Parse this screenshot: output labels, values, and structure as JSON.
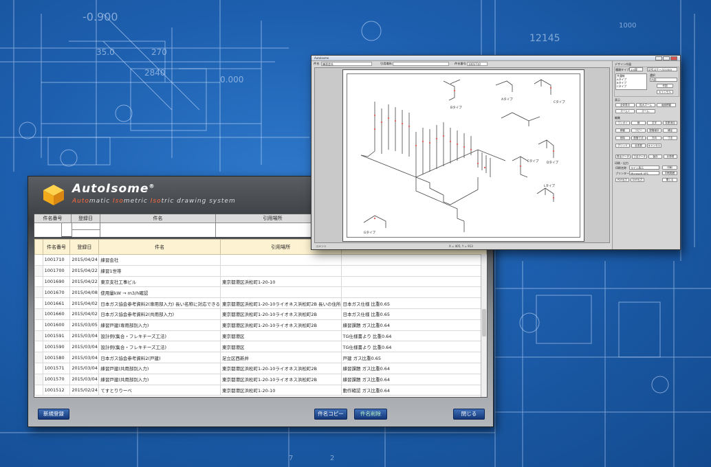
{
  "app": {
    "name_prefix": "AutoIsome",
    "reg_mark": "®",
    "subtitle_parts": [
      {
        "text": "Auto",
        "hl": true
      },
      {
        "text": "matic ",
        "hl": false
      },
      {
        "text": "Iso",
        "hl": true
      },
      {
        "text": "metric ",
        "hl": false
      },
      {
        "text": "Iso",
        "hl": true
      },
      {
        "text": "tric drawing system",
        "hl": false
      }
    ]
  },
  "search": {
    "headers": [
      "件名番号",
      "登録日",
      "件名",
      "引用場所"
    ]
  },
  "table": {
    "headers": [
      "件名番号",
      "登録日",
      "件名",
      "引用場所",
      ""
    ],
    "rows": [
      [
        "1001710",
        "2015/04/24",
        "練習会社",
        "",
        ""
      ],
      [
        "1001700",
        "2015/04/22",
        "練習1世帯",
        "",
        ""
      ],
      [
        "1001690",
        "2015/04/22",
        "東京支社工事ビル",
        "東京都港区浜松町1-20-10",
        ""
      ],
      [
        "1001670",
        "2015/04/08",
        "使用量kW → m3/h確認",
        "",
        ""
      ],
      [
        "1001661",
        "2015/04/02",
        "日本ガス協会参考資料2(専用部入力) 長い名称に対応できる",
        "東京都港区浜松町1-20-10ライオネス浜松町2B 長いの住所",
        "日本ガス仕様 比重0.65"
      ],
      [
        "1001660",
        "2015/04/02",
        "日本ガス協会参考資料2(共用部入力)",
        "東京都港区浜松町1-20-10ライオネス浜松町2B",
        "日本ガス仕様 比重0.65"
      ],
      [
        "1001600",
        "2015/03/05",
        "練習戸建(専用部別入力)",
        "東京都港区浜松町1-20-10ライオネス浜松町2B",
        "練習課題 ガス比重0.64"
      ],
      [
        "1001591",
        "2015/03/04",
        "設計例(集合・フレキチーズ工法)",
        "東京都港区",
        "TG仕様書より 比重0.64"
      ],
      [
        "1001590",
        "2015/03/04",
        "設計例(集合・フレキチーズ工法)",
        "東京都港区",
        "TG仕様書より 比重0.64"
      ],
      [
        "1001580",
        "2015/03/04",
        "日本ガス協会参考資料2(戸建)",
        "足立区西新井",
        "戸建 ガス比重0.65"
      ],
      [
        "1001571",
        "2015/03/04",
        "練習戸建(共用部別入力)",
        "東京都港区浜松町1-20-10ライオネス浜松町2B",
        "練習課題 ガス比重0.64"
      ],
      [
        "1001570",
        "2015/03/04",
        "練習戸建(共用部別入力)",
        "東京都港区浜松町1-20-10ライオネス浜松町2B",
        "練習課題 ガス比重0.64"
      ],
      [
        "1001512",
        "2015/02/24",
        "てすとりりーべ",
        "東京都港区浜松町1-20-10",
        "動作確認 ガス比重0.64"
      ]
    ]
  },
  "buttons": {
    "new": "新規登録",
    "copy": "件名コピー",
    "delete": "件名削除",
    "close": "閉じる"
  },
  "drawing": {
    "title_text": "AutoIsome",
    "field_labels": [
      "件名",
      "引用場所",
      "件名番号"
    ],
    "field_values": [
      "練習会社",
      "",
      "1001710"
    ],
    "type_labels": [
      "Bタイプ",
      "Aタイプ",
      "Cタイプ",
      "Dタイプ",
      "Eタイプ",
      "Lタイプ",
      "Gタイプ"
    ],
    "status_left": "コメント",
    "status_center": "X = 405, Y = 913"
  },
  "side": {
    "section1": "デザイン作図",
    "row1": [
      "種類タイプ",
      "1/4管",
      "記号スケール(1/50)"
    ],
    "list_items": [
      "共通線",
      "Aタイプ",
      "Bタイプ",
      "Cタイプ"
    ],
    "row2": [
      "選択",
      "内容"
    ],
    "row2b": [
      "作図",
      "キャンセル"
    ],
    "section2": "表示",
    "view_btns": [
      "全体表示",
      "拡大ズーム",
      "画面移動",
      "ズーム+",
      "ズーム-"
    ],
    "section3": "編集",
    "edit_btns": [
      "ワンポイ",
      "線",
      "文字",
      "変更追加",
      "移動",
      "コピー",
      "配管継手",
      "補足",
      "削除",
      "配管寸法",
      "方向",
      "寸法",
      "グリッド",
      "全変更",
      "キャンセル"
    ],
    "section4": [
      "算出データ",
      "寸法データ",
      "保存",
      "計算書"
    ],
    "section5": "印刷・出力",
    "print_rows": [
      [
        "印刷名称",
        "ライン表示"
      ],
      [
        "プリンター",
        "Microsoft XPS"
      ]
    ],
    "print_btns": [
      "印刷",
      "印刷範囲",
      "PDF出力",
      "DXF出力",
      "閉じる"
    ]
  }
}
